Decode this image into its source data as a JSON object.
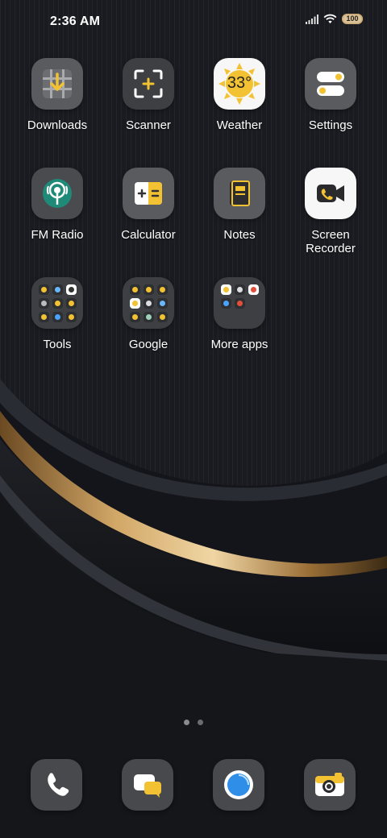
{
  "status_bar": {
    "time": "2:36 AM",
    "battery": "100"
  },
  "apps": [
    {
      "label": "Downloads"
    },
    {
      "label": "Scanner"
    },
    {
      "label": "Weather",
      "temperature": "33°"
    },
    {
      "label": "Settings"
    },
    {
      "label": "FM Radio"
    },
    {
      "label": "Calculator"
    },
    {
      "label": "Notes"
    },
    {
      "label": "Screen Recorder"
    },
    {
      "label": "Tools"
    },
    {
      "label": "Google"
    },
    {
      "label": "More apps"
    }
  ],
  "page_indicator": {
    "pages": 2,
    "current": 1
  },
  "dock": [
    "phone-icon",
    "messages-icon",
    "browser-icon",
    "camera-icon"
  ],
  "colors": {
    "accent": "#f2c232",
    "icon_bg": "#5a5b5f",
    "wallpaper_gold": "#b88a4a"
  }
}
